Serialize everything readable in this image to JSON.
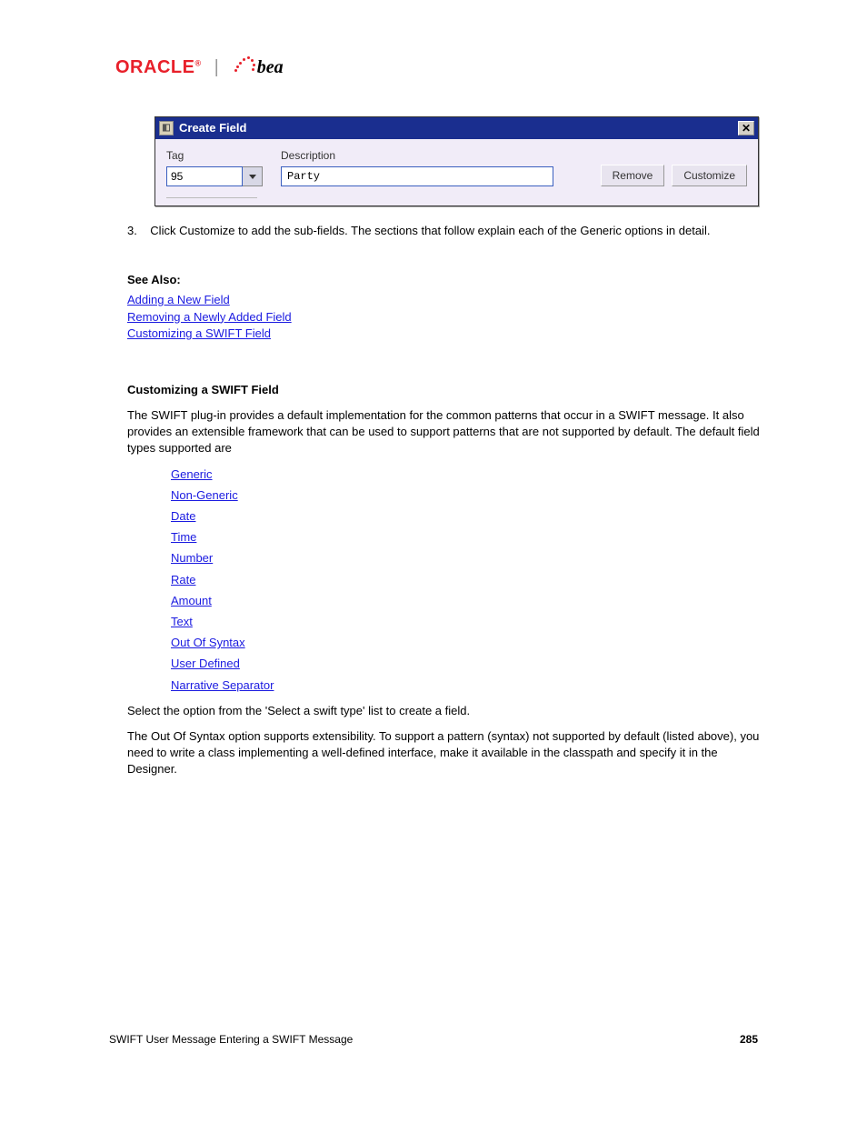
{
  "logo": {
    "oracle": "ORACLE",
    "reg": "®",
    "bea": "bea"
  },
  "dialog": {
    "title": "Create Field",
    "tag_label": "Tag",
    "tag_value": "95",
    "desc_label": "Description",
    "desc_value": "Party",
    "remove": "Remove",
    "customize": "Customize"
  },
  "body": {
    "p1_prefix": "3.",
    "p1": "Click Customize to add the sub-fields. The sections that follow explain each of the Generic options in detail.",
    "see_also": "See Also:",
    "links_a": [
      {
        "label": "Adding a New Field"
      },
      {
        "label": "Removing a Newly Added Field"
      },
      {
        "label": "Customizing a SWIFT Field"
      }
    ],
    "heading": "Customizing a SWIFT Field",
    "p2": "The SWIFT plug-in provides a default implementation for the common patterns that occur in a SWIFT message. It also provides an extensible framework that can be used to support patterns that are not supported by default. The default field types supported are",
    "links_b": [
      {
        "label": "Generic"
      },
      {
        "label": "Non-Generic"
      },
      {
        "label": "Date"
      },
      {
        "label": "Time"
      },
      {
        "label": "Number"
      },
      {
        "label": "Rate"
      },
      {
        "label": "Amount"
      },
      {
        "label": "Text"
      },
      {
        "label": "Out Of Syntax"
      },
      {
        "label": "User Defined"
      },
      {
        "label": "Narrative Separator"
      }
    ],
    "p3_prefix": "Select the option from the ",
    "p3_quote": "'Select a swift type'",
    "p3_suffix": " list to create a field.",
    "p4": "The Out Of Syntax option supports extensibility. To support a pattern (syntax) not supported by default (listed above), you need to write a class implementing a well-defined interface, make it available in the classpath and specify it in the Designer."
  },
  "footer": {
    "left": "SWIFT User Message Entering a SWIFT Message",
    "right": "285"
  }
}
